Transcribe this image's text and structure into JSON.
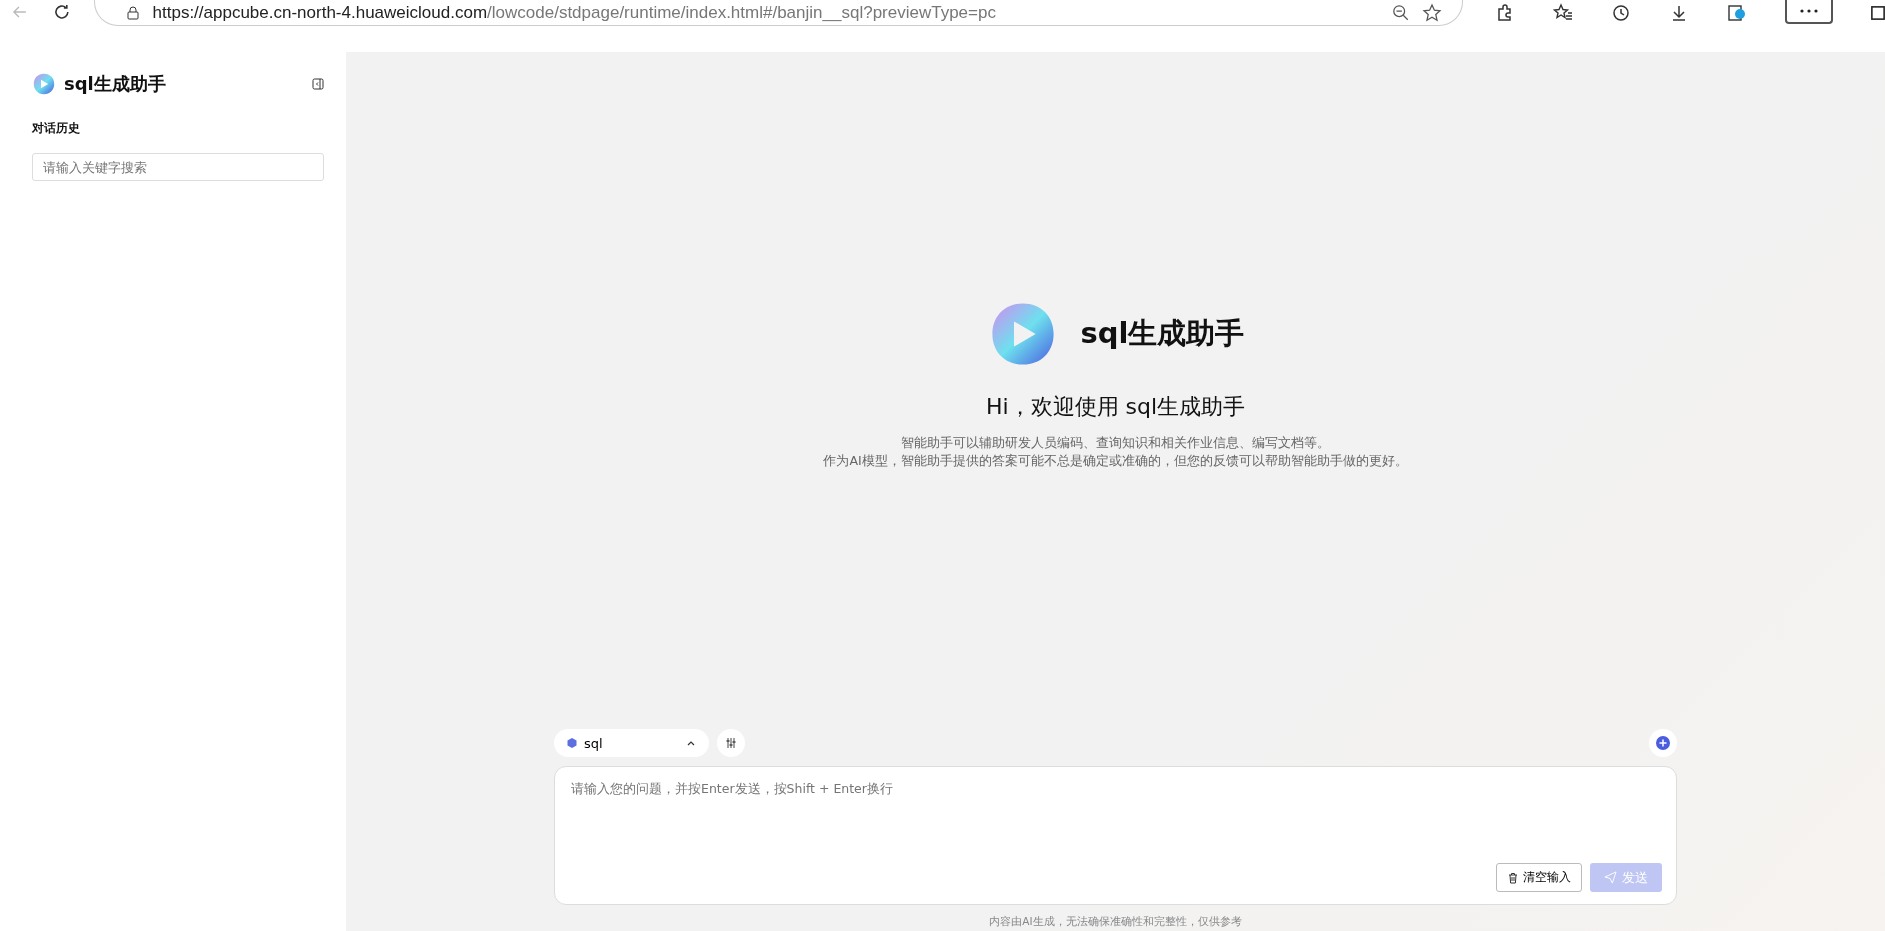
{
  "browser": {
    "url_host": "https://appcube.cn-north-4.huaweicloud.com",
    "url_path": "/lowcode/stdpage/runtime/index.html#/banjin__sql?previewType=pc"
  },
  "sidebar": {
    "app_name": "sql生成助手",
    "history_title": "对话历史",
    "search": {
      "placeholder": "请输入关键字搜索"
    }
  },
  "welcome": {
    "app_name": "sql生成助手",
    "greeting": "Hi，欢迎使用 sql生成助手",
    "lines": [
      "智能助手可以辅助研发人员编码、查询知识和相关作业信息、编写文档等。",
      "作为AI模型，智能助手提供的答案可能不总是确定或准确的，但您的反馈可以帮助智能助手做的更好。"
    ]
  },
  "composer": {
    "model": "sql",
    "input": {
      "placeholder": "请输入您的问题，并按Enter发送，按Shift + Enter换行"
    },
    "clear_button": "清空输入",
    "send_button": {
      "label": "发送",
      "disabled": true
    }
  },
  "footer_note": "内容由AI生成，无法确保准确性和完整性，仅供参考"
}
